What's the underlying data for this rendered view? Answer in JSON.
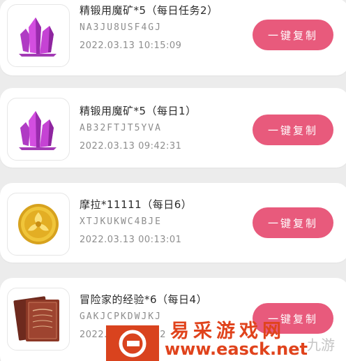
{
  "items": [
    {
      "title": "精锻用魔矿*5（每日任务2）",
      "code": "NA3JU8USF4GJ",
      "time": "2022.03.13 10:15:09",
      "button": "一键复制",
      "icon": "purple-crystal-icon"
    },
    {
      "title": "精锻用魔矿*5（每日1）",
      "code": "AB32FTJT5YVA",
      "time": "2022.03.13 09:42:31",
      "button": "一键复制",
      "icon": "purple-crystal-icon"
    },
    {
      "title": "摩拉*11111（每日6）",
      "code": "XTJKUKWC4BJE",
      "time": "2022.03.13 00:13:01",
      "button": "一键复制",
      "icon": "mora-coin-icon"
    },
    {
      "title": "冒险家的经验*6（每日4）",
      "code": "GAKJCPKDWJKJ",
      "time": "2022.03.13 00:12",
      "button": "一键复制",
      "icon": "experience-book-icon"
    }
  ],
  "watermark": {
    "site_name": "易采游戏网",
    "url": "www.easck.net",
    "faint_text": "九游"
  },
  "colors": {
    "button": "#e85a7c",
    "watermark": "#e0431c",
    "background": "#ececec"
  }
}
